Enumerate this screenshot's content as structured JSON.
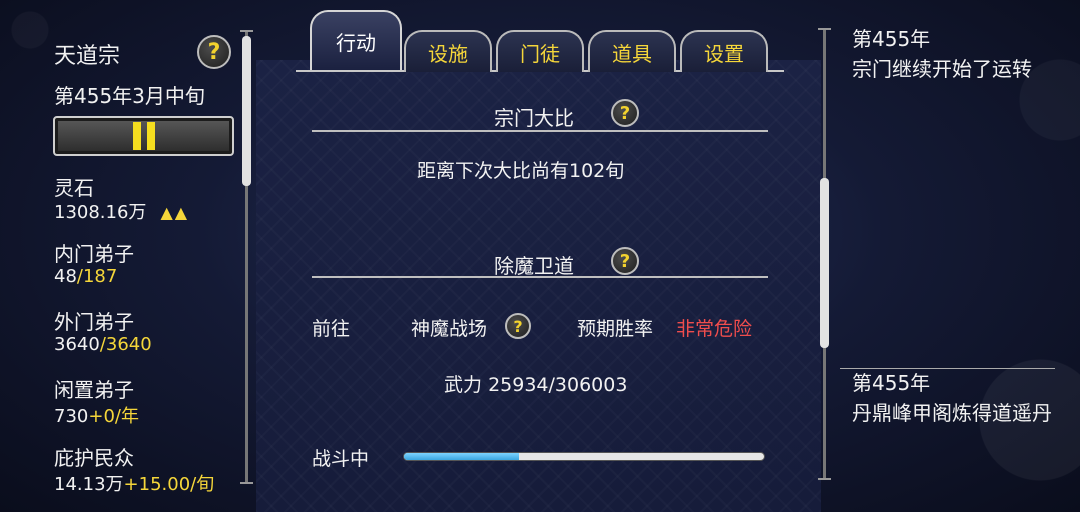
{
  "sidebar": {
    "sect_name": "天道宗",
    "date": "第455年3月中旬",
    "help_icon": "?",
    "pause_icon": "pause-icon",
    "stats": [
      {
        "label": "灵石",
        "value": "1308.16万",
        "arrows": "▲▲"
      },
      {
        "label": "内门弟子",
        "value": "48",
        "extra": "/187"
      },
      {
        "label": "外门弟子",
        "value": "3640",
        "extra": "/3640"
      },
      {
        "label": "闲置弟子",
        "value": "730",
        "extra": "+0/年"
      },
      {
        "label": "庇护民众",
        "value": "14.13万",
        "extra": "+15.00/旬"
      }
    ]
  },
  "tabs": [
    {
      "label": "行动",
      "active": true
    },
    {
      "label": "设施",
      "active": false
    },
    {
      "label": "门徒",
      "active": false
    },
    {
      "label": "道具",
      "active": false
    },
    {
      "label": "设置",
      "active": false
    }
  ],
  "main": {
    "tournament": {
      "title": "宗门大比",
      "countdown": "距离下次大比尚有102旬"
    },
    "demon": {
      "title": "除魔卫道",
      "goto_label": "前往",
      "location": "神魔战场",
      "win_rate_label": "预期胜率",
      "win_rate_value": "非常危险",
      "power_label": "武力",
      "power_value": "25934/306003",
      "status": "战斗中",
      "progress": 0.32
    }
  },
  "log": [
    {
      "year": "第455年",
      "text": "宗门继续开始了运转"
    },
    {
      "year": "第455年",
      "text": "丹鼎峰甲阁炼得道遥丹"
    }
  ],
  "colors": {
    "accent_yellow": "#f5d63a",
    "danger_red": "#ef4d4d",
    "progress_blue": "#5ab8ec"
  }
}
